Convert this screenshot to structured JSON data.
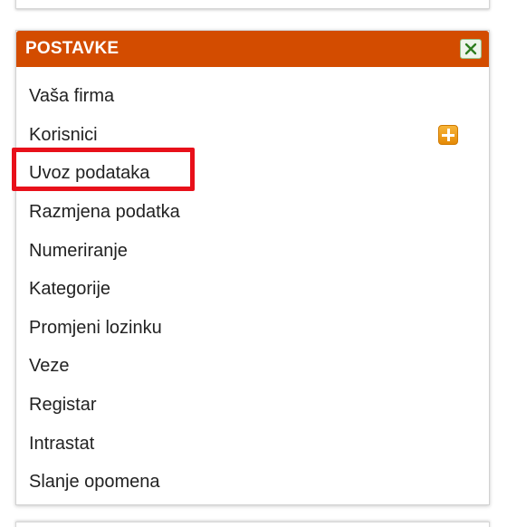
{
  "panel": {
    "title": "POSTAVKE",
    "close_icon": "close-icon",
    "add_icon": "plus-icon",
    "colors": {
      "header": "#d34c00",
      "highlight": "#e8101a",
      "add_button": "#f29a1b",
      "close_button_border": "#9ac48c"
    },
    "items": [
      {
        "label": "Vaša firma"
      },
      {
        "label": "Korisnici"
      },
      {
        "label": "Uvoz podataka"
      },
      {
        "label": "Razmjena podatka"
      },
      {
        "label": "Numeriranje"
      },
      {
        "label": "Kategorije"
      },
      {
        "label": "Promjeni lozinku"
      },
      {
        "label": "Veze"
      },
      {
        "label": "Registar"
      },
      {
        "label": "Intrastat"
      },
      {
        "label": "Slanje opomena"
      }
    ]
  }
}
